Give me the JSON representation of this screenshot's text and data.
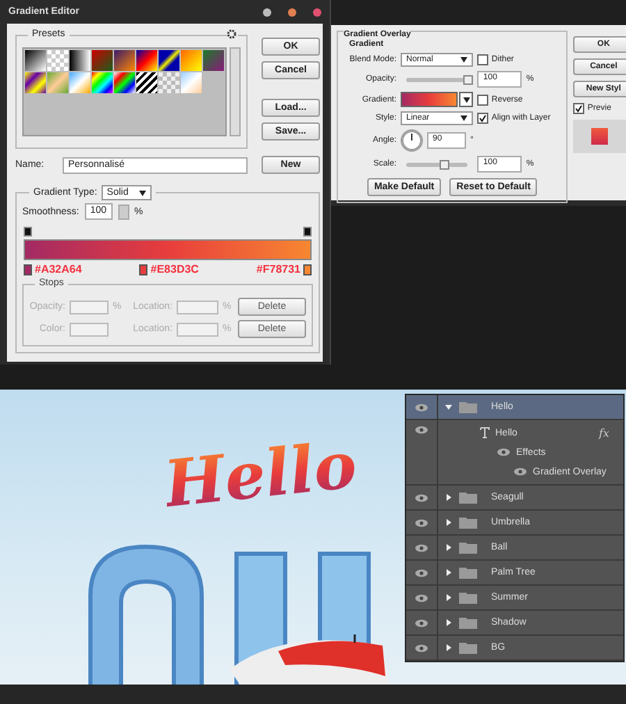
{
  "gradient_editor": {
    "title": "Gradient Editor",
    "presets_label": "Presets",
    "buttons": [
      "OK",
      "Cancel",
      "Load...",
      "Save..."
    ],
    "name_label": "Name:",
    "name_value": "Personnalisé",
    "new_button": "New",
    "gradient_type_label": "Gradient Type:",
    "gradient_type_value": "Solid",
    "smoothness_label": "Smoothness:",
    "smoothness_value": "100",
    "smoothness_unit": "%",
    "color_stops": [
      {
        "label": "#A32A64",
        "color": "#a32a64"
      },
      {
        "label": "#E83D3C",
        "color": "#e83d3c"
      },
      {
        "label": "#F78731",
        "color": "#f78731"
      }
    ],
    "stops": {
      "title": "Stops",
      "rows": [
        {
          "label": "Opacity:",
          "unit": "%",
          "location_label": "Location:",
          "location_unit": "%",
          "button": "Delete"
        },
        {
          "label": "Color:",
          "location_label": "Location:",
          "location_unit": "%",
          "button": "Delete"
        }
      ]
    }
  },
  "gradient_overlay": {
    "title": "Gradient Overlay",
    "section": "Gradient",
    "blend_mode_label": "Blend Mode:",
    "blend_mode": "Normal",
    "dither": {
      "label": "Dither",
      "checked": false
    },
    "opacity_label": "Opacity:",
    "opacity_slider": {
      "level": 1
    },
    "opacity_value": "100",
    "opacity_unit": "%",
    "gradient_label": "Gradient:",
    "reverse": {
      "label": "Reverse",
      "checked": false
    },
    "style_label": "Style:",
    "style": "Linear",
    "align": {
      "label": "Align with Layer",
      "checked": true
    },
    "angle_label": "Angle:",
    "angle_value": "90",
    "angle_unit": "°",
    "scale_label": "Scale:",
    "scale_slider": {
      "level": 0.6
    },
    "scale_value": "100",
    "scale_unit": "%",
    "buttons": [
      "Make Default",
      "Reset to Default"
    ],
    "side_buttons": [
      "OK",
      "Cancel",
      "New Styl"
    ],
    "preview": {
      "label": "Previe",
      "checked": true
    }
  },
  "canvas": {
    "headline": "Hello"
  },
  "layers": [
    {
      "name": "Hello",
      "kind": "group",
      "expanded": true,
      "selected": true,
      "children": [
        {
          "name": "Hello",
          "kind": "text",
          "fx": "fx",
          "children": [
            {
              "name": "Effects",
              "kind": "effects",
              "children": [
                {
                  "name": "Gradient Overlay",
                  "kind": "effect"
                }
              ]
            }
          ]
        }
      ]
    },
    {
      "name": "Seagull",
      "kind": "group",
      "expanded": false,
      "selected": false
    },
    {
      "name": "Umbrella",
      "kind": "group",
      "expanded": false,
      "selected": false
    },
    {
      "name": "Ball",
      "kind": "group",
      "expanded": false,
      "selected": false
    },
    {
      "name": "Palm Tree",
      "kind": "group",
      "expanded": false,
      "selected": false
    },
    {
      "name": "Summer",
      "kind": "group",
      "expanded": false,
      "selected": false
    },
    {
      "name": "Shadow",
      "kind": "group",
      "expanded": false,
      "selected": false
    },
    {
      "name": "BG",
      "kind": "group",
      "expanded": false,
      "selected": false
    }
  ]
}
